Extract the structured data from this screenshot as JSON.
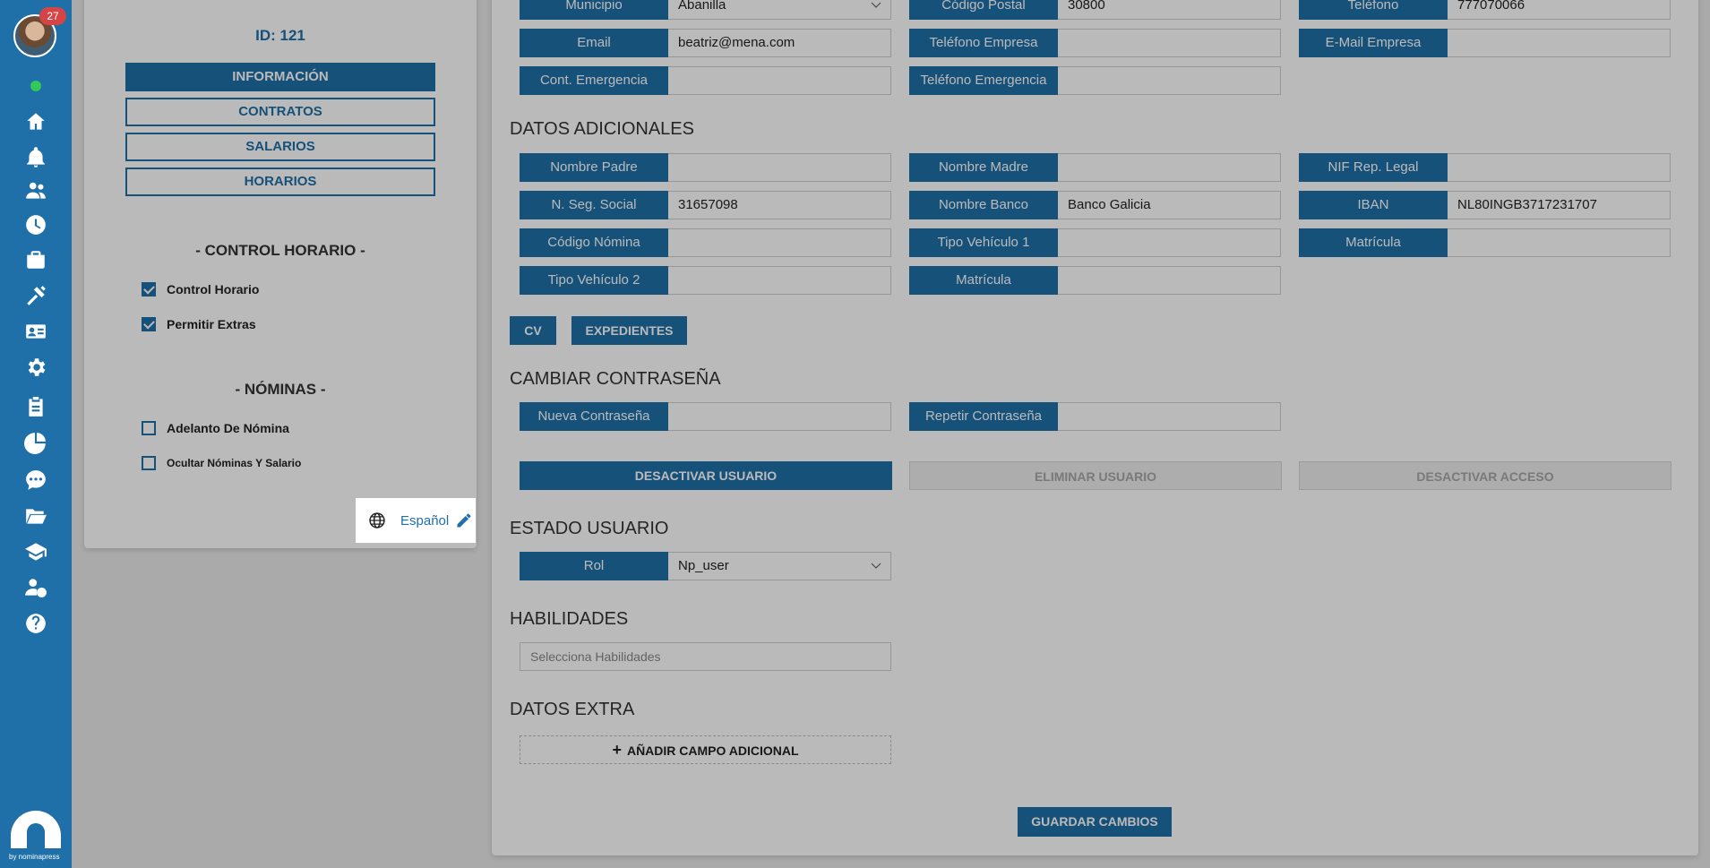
{
  "sidebar": {
    "notification_count": "27",
    "brand_text": "by nominapress",
    "icons": [
      "home-icon",
      "bell-icon",
      "users-icon",
      "clock-icon",
      "briefcase-icon",
      "tools-icon",
      "id-card-icon",
      "gear-icon",
      "clipboard-icon",
      "pie-chart-icon",
      "chat-icon",
      "folder-icon",
      "graduation-cap-icon",
      "user-dollar-icon",
      "help-icon"
    ]
  },
  "left": {
    "user_id": "ID: 121",
    "tabs": {
      "informacion": "INFORMACIÓN",
      "contratos": "CONTRATOS",
      "salarios": "SALARIOS",
      "horarios": "HORARIOS"
    },
    "control_horario": {
      "title": "- CONTROL HORARIO -",
      "control_horario": "Control Horario",
      "permitir_extras": "Permitir Extras"
    },
    "nominas": {
      "title": "- NÓMINAS -",
      "adelanto": "Adelanto De Nómina",
      "ocultar": "Ocultar Nóminas Y Salario"
    },
    "language": "Español"
  },
  "contact": {
    "municipio_label": "Municipio",
    "municipio_value": "Abanilla",
    "codigo_postal_label": "Código Postal",
    "codigo_postal_value": "30800",
    "telefono_label": "Teléfono",
    "telefono_value": "777070066",
    "email_label": "Email",
    "email_value": "beatriz@mena.com",
    "telefono_empresa_label": "Teléfono Empresa",
    "telefono_empresa_value": "",
    "email_empresa_label": "E-Mail Empresa",
    "email_empresa_value": "",
    "cont_emergencia_label": "Cont. Emergencia",
    "cont_emergencia_value": "",
    "telefono_emergencia_label": "Teléfono Emergencia",
    "telefono_emergencia_value": ""
  },
  "adicionales": {
    "title": "DATOS ADICIONALES",
    "nombre_padre_label": "Nombre Padre",
    "nombre_padre_value": "",
    "nombre_madre_label": "Nombre Madre",
    "nombre_madre_value": "",
    "nif_label": "NIF Rep. Legal",
    "nif_value": "",
    "nss_label": "N. Seg. Social",
    "nss_value": "31657098",
    "banco_label": "Nombre Banco",
    "banco_value": "Banco Galicia",
    "iban_label": "IBAN",
    "iban_value": "NL80INGB3717231707",
    "codigo_nomina_label": "Código Nómina",
    "codigo_nomina_value": "",
    "tipo_vehiculo1_label": "Tipo Vehículo 1",
    "tipo_vehiculo1_value": "",
    "matricula1_label": "Matrícula",
    "matricula1_value": "",
    "tipo_vehiculo2_label": "Tipo Vehículo 2",
    "tipo_vehiculo2_value": "",
    "matricula2_label": "Matrícula",
    "matricula2_value": "",
    "cv_button": "CV",
    "expedientes_button": "EXPEDIENTES"
  },
  "password": {
    "title": "CAMBIAR CONTRASEÑA",
    "nueva_label": "Nueva Contraseña",
    "nueva_value": "",
    "repetir_label": "Repetir Contraseña",
    "repetir_value": ""
  },
  "actions": {
    "desactivar_usuario": "DESACTIVAR USUARIO",
    "eliminar_usuario": "ELIMINAR USUARIO",
    "desactivar_acceso": "DESACTIVAR ACCESO"
  },
  "estado": {
    "title": "ESTADO USUARIO",
    "rol_label": "Rol",
    "rol_value": "Np_user"
  },
  "habilidades": {
    "title": "HABILIDADES",
    "placeholder": "Selecciona Habilidades"
  },
  "extra": {
    "title": "DATOS EXTRA",
    "add_button": "AÑADIR CAMPO ADICIONAL"
  },
  "save_button": "GUARDAR CAMBIOS",
  "colors": {
    "primary": "#1f6fa8",
    "notification": "#d64545",
    "online": "#34c759"
  }
}
